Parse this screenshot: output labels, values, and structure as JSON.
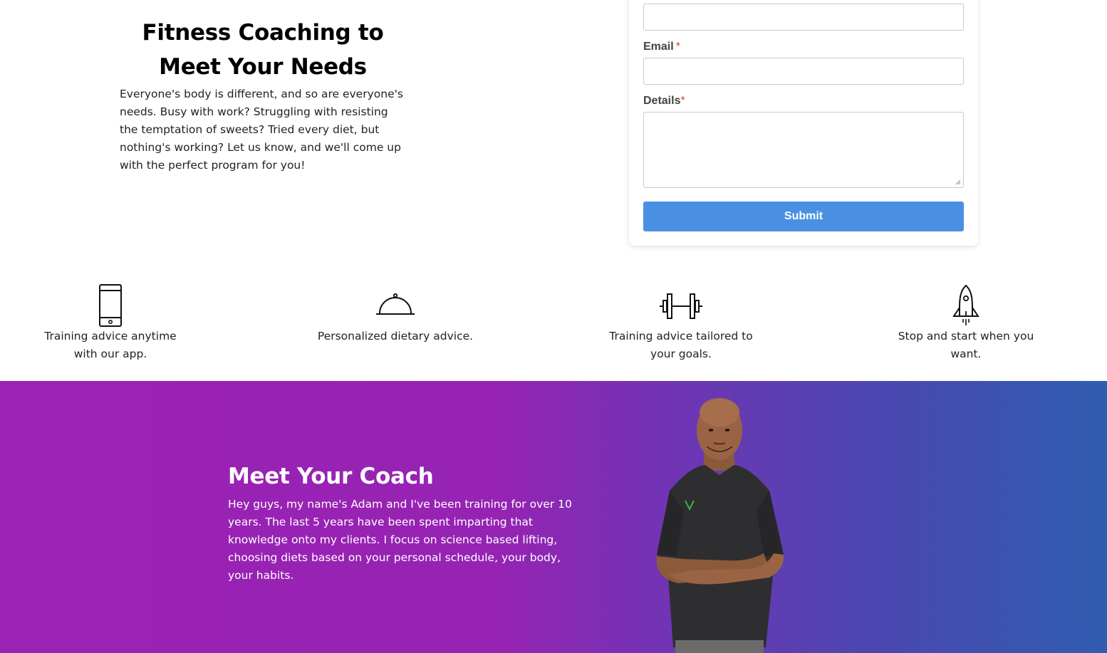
{
  "hero": {
    "title_line1": "Fitness Coaching to",
    "title_line2": "Meet Your Needs",
    "description": "Everyone's body is different, and so are everyone's needs. Busy with work? Struggling with resisting the temptation of sweets? Tried every diet, but nothing's working? Let us know, and we'll come up with the perfect program for you!"
  },
  "form": {
    "name_value": "",
    "email_label": "Email",
    "email_value": "",
    "details_label": "Details",
    "details_value": "",
    "required_marker": "*",
    "submit_label": "Submit",
    "accent_color": "#4a90e2"
  },
  "features": [
    {
      "icon": "smartphone-icon",
      "label": "Training advice anytime with our app."
    },
    {
      "icon": "food-cloche-icon",
      "label": "Personalized dietary advice."
    },
    {
      "icon": "dumbbell-icon",
      "label": "Training advice tailored to your goals."
    },
    {
      "icon": "rocket-icon",
      "label": "Stop and start when you want."
    }
  ],
  "coach": {
    "title": "Meet Your Coach",
    "bio": "Hey guys, my name's Adam and I've been training for over 10 years. The last 5 years have been spent imparting that knowledge onto my clients. I focus on science based lifting, choosing diets based on your personal schedule, your body, your habits.",
    "gradient_start": "#9b22b4",
    "gradient_end": "#2f5db0"
  }
}
